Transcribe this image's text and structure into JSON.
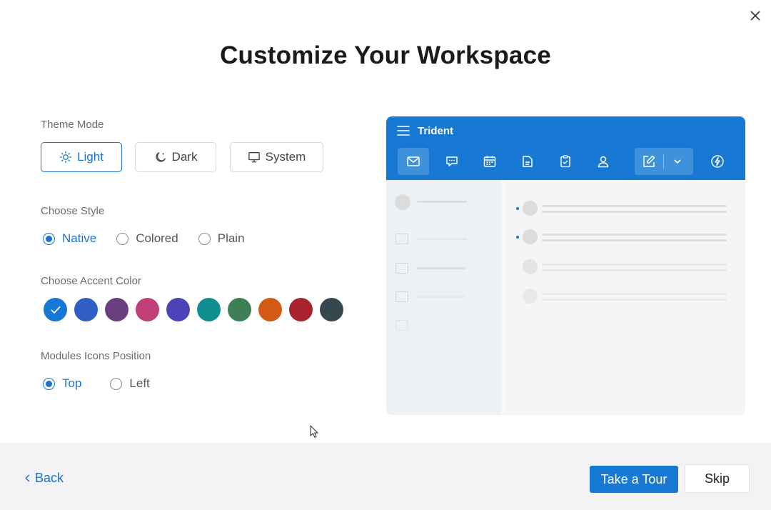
{
  "dialog": {
    "title": "Customize Your Workspace",
    "close_icon": "close-icon"
  },
  "theme": {
    "label": "Theme Mode",
    "options": [
      {
        "label": "Light",
        "icon": "sun-icon",
        "active": true
      },
      {
        "label": "Dark",
        "icon": "moon-icon",
        "active": false
      },
      {
        "label": "System",
        "icon": "monitor-icon",
        "active": false
      }
    ]
  },
  "style": {
    "label": "Choose Style",
    "options": [
      {
        "label": "Native",
        "selected": true
      },
      {
        "label": "Colored",
        "selected": false
      },
      {
        "label": "Plain",
        "selected": false
      }
    ]
  },
  "accent": {
    "label": "Choose Accent Color",
    "selected_index": 0,
    "colors": [
      "#1478d4",
      "#2f5fc4",
      "#6b3f7f",
      "#c13f78",
      "#4a44b8",
      "#0f8f8f",
      "#3f7f55",
      "#d35a14",
      "#a8232e",
      "#37474f"
    ]
  },
  "modules": {
    "label": "Modules Icons Position",
    "options": [
      {
        "label": "Top",
        "selected": true
      },
      {
        "label": "Left",
        "selected": false
      }
    ]
  },
  "preview": {
    "app_name": "Trident",
    "header_color": "#1779d4",
    "icons": [
      "mail-icon",
      "chat-icon",
      "calendar-icon",
      "document-icon",
      "tasks-icon",
      "contacts-icon",
      "compose-icon",
      "chevron-down-icon",
      "lightning-icon"
    ]
  },
  "footer": {
    "back_label": "Back",
    "tour_label": "Take a Tour",
    "skip_label": "Skip"
  }
}
